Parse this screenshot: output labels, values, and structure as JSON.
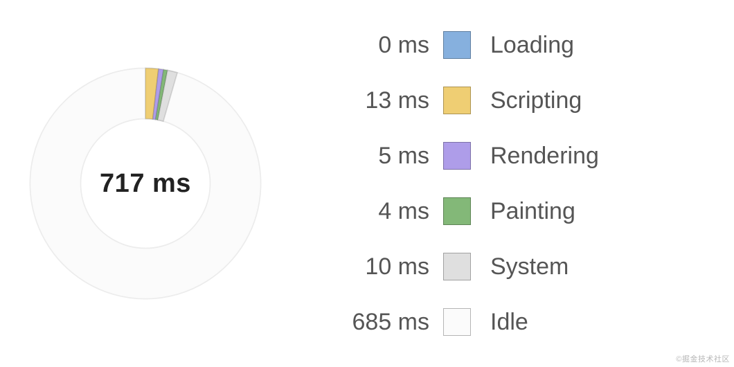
{
  "unit": "ms",
  "center_label": "717 ms",
  "chart_data": {
    "type": "pie",
    "title": "",
    "unit": "ms",
    "total": 717,
    "series": [
      {
        "name": "Loading",
        "value": 0,
        "color": "#86B0DE"
      },
      {
        "name": "Scripting",
        "value": 13,
        "color": "#EFCE73"
      },
      {
        "name": "Rendering",
        "value": 5,
        "color": "#AE9DE9"
      },
      {
        "name": "Painting",
        "value": 4,
        "color": "#83B878"
      },
      {
        "name": "System",
        "value": 10,
        "color": "#DFDFDF"
      },
      {
        "name": "Idle",
        "value": 685,
        "color": "#FBFBFB"
      }
    ]
  },
  "legend": {
    "items": [
      {
        "value": "0 ms",
        "label": "Loading"
      },
      {
        "value": "13 ms",
        "label": "Scripting"
      },
      {
        "value": "5 ms",
        "label": "Rendering"
      },
      {
        "value": "4 ms",
        "label": "Painting"
      },
      {
        "value": "10 ms",
        "label": "System"
      },
      {
        "value": "685 ms",
        "label": "Idle"
      }
    ]
  },
  "watermark": "©掘金技术社区"
}
